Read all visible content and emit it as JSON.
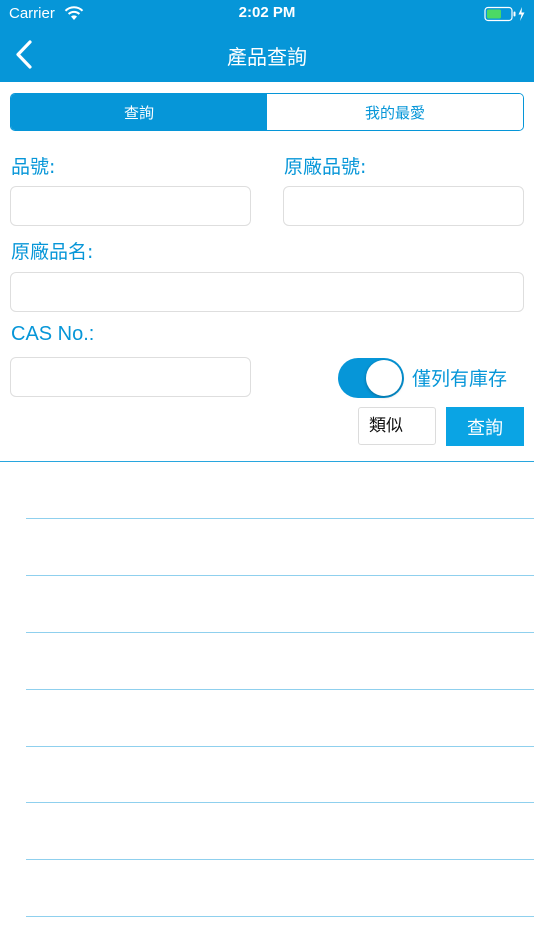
{
  "status_bar": {
    "carrier": "Carrier",
    "time": "2:02 PM"
  },
  "nav": {
    "title": "產品查詢",
    "back_icon": "chevron-left-icon"
  },
  "tabs": [
    {
      "label": "查詢",
      "active": true
    },
    {
      "label": "我的最愛",
      "active": false
    }
  ],
  "form": {
    "part_no_label": "品號:",
    "part_no_value": "",
    "mfr_part_no_label": "原廠品號:",
    "mfr_part_no_value": "",
    "mfr_name_label": "原廠品名:",
    "mfr_name_value": "",
    "cas_label": "CAS No.:",
    "cas_value": "",
    "stock_toggle_label": "僅列有庫存",
    "stock_toggle_on": true,
    "match_mode": "類似",
    "search_button": "查詢"
  },
  "colors": {
    "primary": "#0696d8",
    "search_button": "#0aa4e4",
    "row_divider": "#8fd0ee"
  },
  "result_rows": 8
}
